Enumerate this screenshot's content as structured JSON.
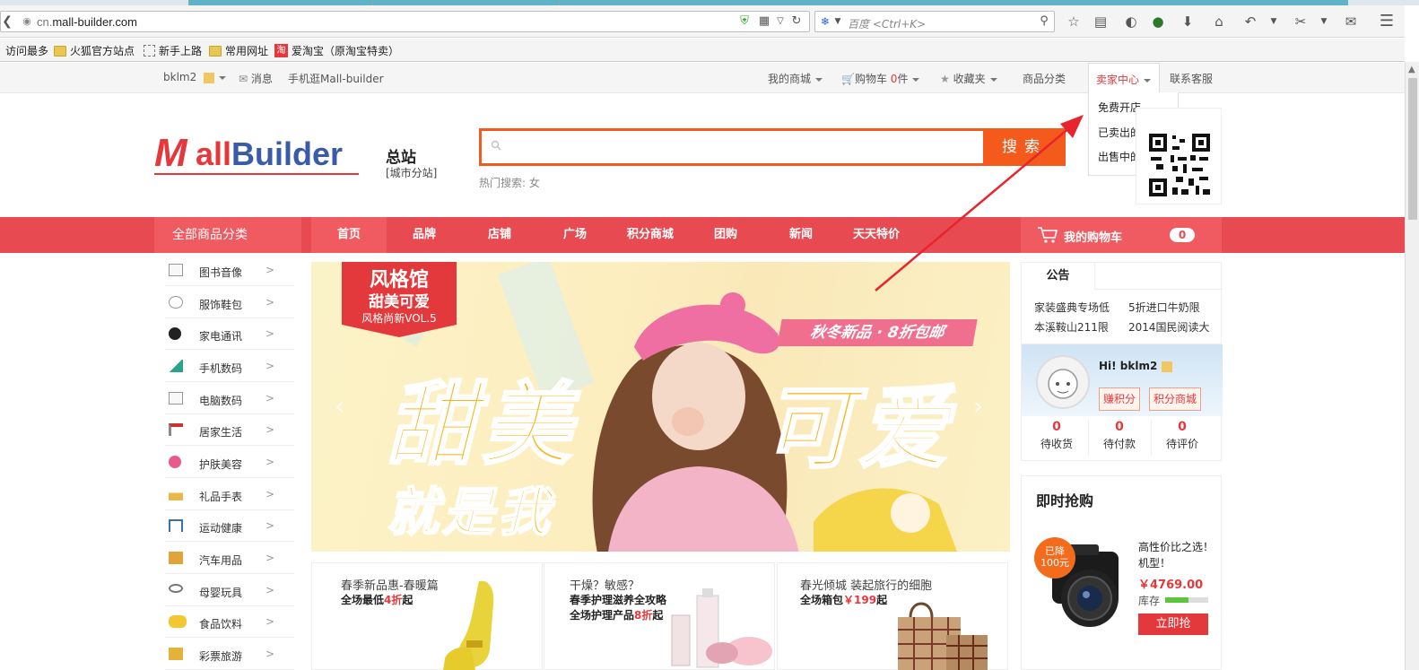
{
  "browser": {
    "url_host": "cn.",
    "url_domain": "mall-builder.com",
    "search_placeholder": "百度 <Ctrl+K>",
    "bookmarks": [
      "访问最多",
      "火狐官方站点",
      "新手上路",
      "常用网址",
      "爱淘宝（原淘宝特卖）"
    ],
    "bookmark_badge": "淘"
  },
  "topbar": {
    "user": "bklm2",
    "messages": "消息",
    "mobile": "手机逛Mall-builder",
    "my_mall": "我的商城",
    "cart_prefix": "购物车",
    "cart_count": "0",
    "cart_unit": "件",
    "favorites": "收藏夹",
    "categories": "商品分类",
    "seller_center": "卖家中心",
    "service": "联系客服"
  },
  "seller_menu": [
    "免费开店",
    "已卖出的商品",
    "出售中的商品"
  ],
  "header": {
    "logo_m": "M",
    "logo_r": "all",
    "logo_b": "Builder",
    "site_name": "总站",
    "city_site": "[城市分站]",
    "search_button": "搜索",
    "hot_search": "热门搜索: 女"
  },
  "nav": {
    "all_categories": "全部商品分类",
    "items": [
      "首页",
      "品牌",
      "店铺",
      "广场",
      "积分商城",
      "团购",
      "新闻",
      "天天特价"
    ],
    "cart_label": "我的购物车",
    "cart_count": "0"
  },
  "categories": [
    "图书音像",
    "服饰鞋包",
    "家电通讯",
    "手机数码",
    "电脑数码",
    "居家生活",
    "护肤美容",
    "礼品手表",
    "运动健康",
    "汽车用品",
    "母婴玩具",
    "食品饮料",
    "彩票旅游"
  ],
  "banner": {
    "tag1": "风格馆",
    "tag2": "甜美可爱",
    "tag3": "风格尚新VOL.5",
    "promo": "秋冬新品 · 8折包邮",
    "big1": "甜美",
    "big2": "可爱",
    "big3": "就是我"
  },
  "sub_banners": [
    {
      "t1": "春季新品惠-春暖篇",
      "t2_pre": "全场最低",
      "t2_red": "4折",
      "t2_post": "起",
      "t3": ""
    },
    {
      "t1": "干燥？敏感？",
      "t2_pre": "春季护理滋养全攻略",
      "t2_red": "",
      "t2_post": "",
      "t3_pre": "全场护理产品",
      "t3_red": "8折",
      "t3_post": "起"
    },
    {
      "t1": "春光倾城 装起旅行的细胞",
      "t2_pre": "全场箱包",
      "t2_red": "￥199",
      "t2_post": "起",
      "t3": ""
    }
  ],
  "notice": {
    "tab": "公告",
    "items": [
      "家装盛典专场低",
      "5折进口牛奶限",
      "本溪鞍山211限",
      "2014国民阅读大"
    ]
  },
  "userbox": {
    "hi": "Hi! bklm2",
    "earn_points": "赚积分",
    "points_mall": "积分商城",
    "stats": [
      {
        "num": "0",
        "label": "待收货"
      },
      {
        "num": "0",
        "label": "待付款"
      },
      {
        "num": "0",
        "label": "待评价"
      }
    ]
  },
  "flash": {
    "title": "即时抢购",
    "badge1": "已降",
    "badge2": "100元",
    "name": "高性价比之选！机型！",
    "price": "￥4769.00",
    "stock_label": "库存",
    "stock_fraction": 0.55,
    "buy": "立即抢"
  },
  "colors": {
    "accent": "#e84a52",
    "search": "#f45a1b",
    "price": "#e4393c"
  }
}
